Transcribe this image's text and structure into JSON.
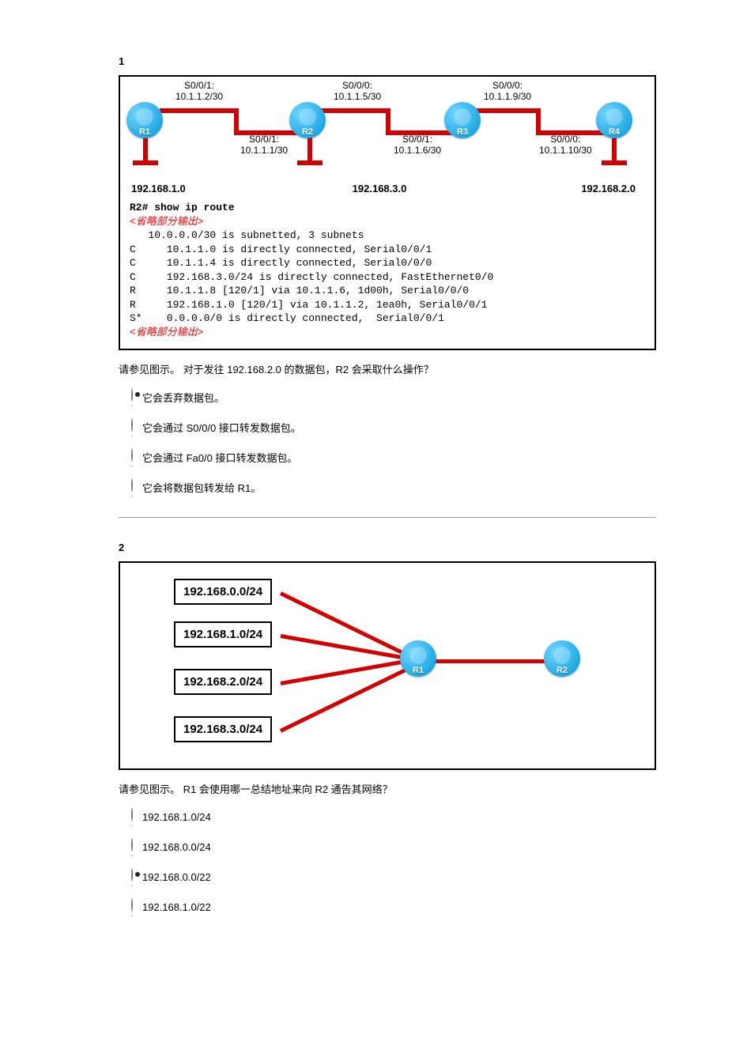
{
  "q1": {
    "number": "1",
    "diagram": {
      "r1": "R1",
      "r2": "R2",
      "r3": "R3",
      "r4": "R4",
      "if_r1_top": "S0/0/1:\n10.1.1.2/30",
      "if_r2_bot": "S0/0/1:\n10.1.1.1/30",
      "if_r2_top": "S0/0/0:\n10.1.1.5/30",
      "if_r3_bot": "S0/0/1:\n10.1.1.6/30",
      "if_r3_top": "S0/0/0:\n10.1.1.9/30",
      "if_r4_bot": "S0/0/0:\n10.1.1.10/30",
      "net1": "192.168.1.0",
      "net2": "192.168.3.0",
      "net3": "192.168.2.0"
    },
    "cli": {
      "prompt": "R2# show ip route",
      "omit": "<省略部分输出>",
      "l1": "   10.0.0.0/30 is subnetted, 3 subnets",
      "l2": "C     10.1.1.0 is directly connected, Serial0/0/1",
      "l3": "C     10.1.1.4 is directly connected, Serial0/0/0",
      "l4": "C     192.168.3.0/24 is directly connected, FastEthernet0/0",
      "l5": "R     10.1.1.8 [120/1] via 10.1.1.6, 1d00h, Serial0/0/0",
      "l6": "R     192.168.1.0 [120/1] via 10.1.1.2, 1ea0h, Serial0/0/1",
      "l7": "S*    0.0.0.0/0 is directly connected,  Serial0/0/1"
    },
    "question": "请参见图示。 对于发往 192.168.2.0 的数据包，R2 会采取什么操作？",
    "options": [
      "它会丢弃数据包。",
      "它会通过 S0/0/0 接口转发数据包。",
      "它会通过 Fa0/0 接口转发数据包。",
      "它会将数据包转发给 R1。"
    ],
    "selected": 0
  },
  "q2": {
    "number": "2",
    "nets": [
      "192.168.0.0/24",
      "192.168.1.0/24",
      "192.168.2.0/24",
      "192.168.3.0/24"
    ],
    "r1": "R1",
    "r2": "R2",
    "question": "请参见图示。 R1 会使用哪一总结地址来向 R2 通告其网络？",
    "options": [
      "192.168.1.0/24",
      "192.168.0.0/24",
      "192.168.0.0/22",
      "192.168.1.0/22"
    ],
    "selected": 2
  }
}
